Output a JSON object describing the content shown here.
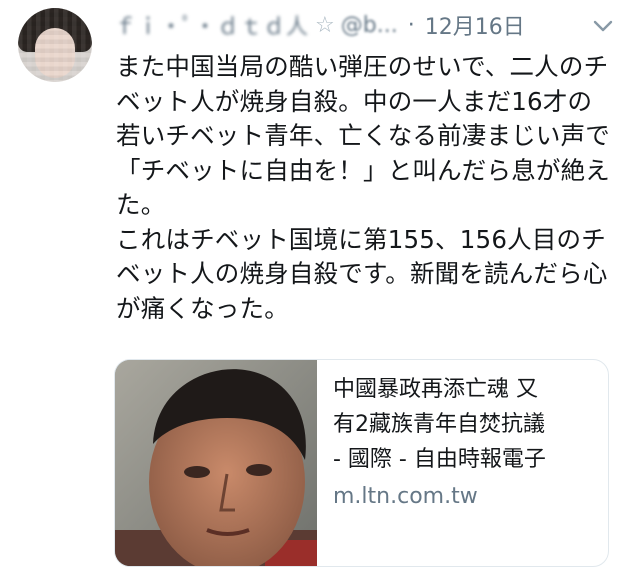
{
  "author": {
    "display_name": "ｆｉ・ﾟ・ｄｔｄ人",
    "handle": "@b...",
    "date": "12月16日"
  },
  "tweet": {
    "text": "また中国当局の酷い弾圧のせいで、二人のチベット人が焼身自殺。中の一人まだ16才の若いチベット青年、亡くなる前凄まじい声で「チベットに自由を！」と叫んだら息が絶えた。\nこれはチベット国境に第155、156人目のチベット人の焼身自殺です。新聞を読んだら心が痛くなった。"
  },
  "card": {
    "title_line1": "中國暴政再添亡魂 又",
    "title_line2": "有2藏族青年自焚抗議",
    "title_line3": "- 國際 - 自由時報電子",
    "domain": "m.ltn.com.tw"
  },
  "icons": {
    "more": "chevron-down-icon",
    "verified_like": "star-icon"
  },
  "colors": {
    "text": "#14171a",
    "secondary": "#657786",
    "border": "#e1e8ed"
  }
}
